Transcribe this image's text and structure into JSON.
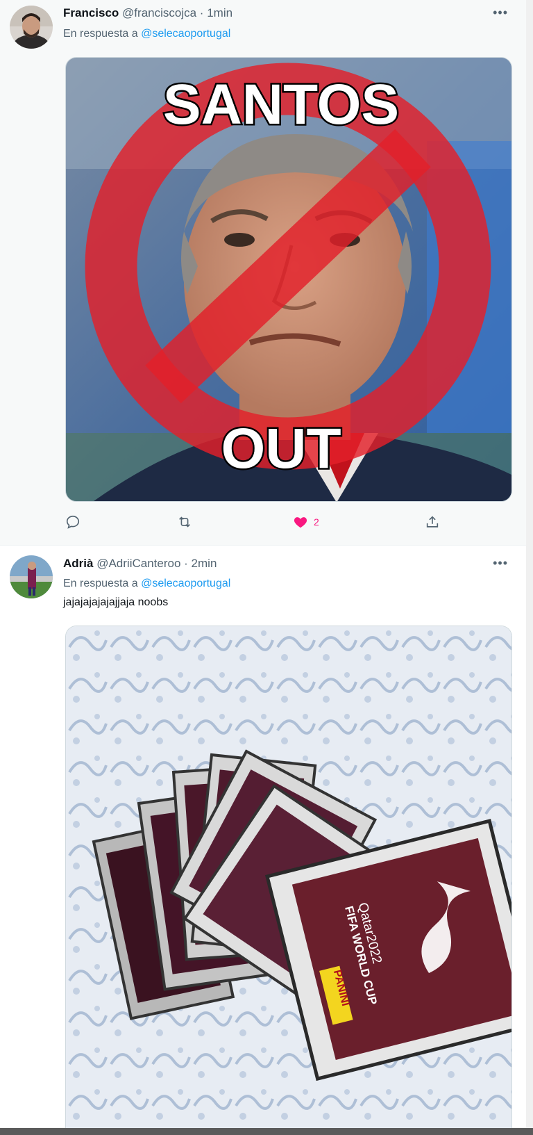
{
  "tweets": [
    {
      "author_name": "Francisco",
      "author_handle": "@franciscojca",
      "separator": "·",
      "time": "1min",
      "reply_prefix": "En respuesta a",
      "reply_to": "@selecaoportugal",
      "image_text_top": "SANTOS",
      "image_text_bottom": "OUT",
      "like_count": "2",
      "liked": true
    },
    {
      "author_name": "Adrià",
      "author_handle": "@AdriiCanteroo",
      "separator": "·",
      "time": "2min",
      "reply_prefix": "En respuesta a",
      "reply_to": "@selecaoportugal",
      "text": "jajajajajajajjaja noobs",
      "image_pack_text_1": "FIFA WORLD CUP",
      "image_pack_text_2": "Qatar2022",
      "image_pack_brand": "PANINI"
    }
  ],
  "icons": {
    "more": "more-horizontal-icon",
    "reply": "reply-bubble-icon",
    "retweet": "retweet-icon",
    "like": "heart-icon",
    "share": "share-upload-icon"
  },
  "colors": {
    "link": "#1d9bf0",
    "like": "#f91880",
    "muted": "#536471",
    "prohibition_red": "#e3202a"
  }
}
